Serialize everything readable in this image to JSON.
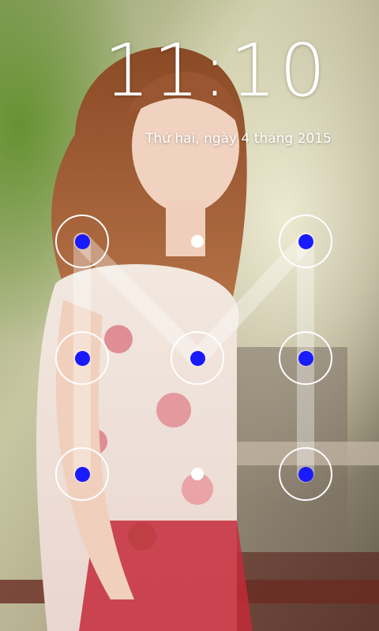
{
  "lockscreen": {
    "time": "11:10",
    "date": "Thứ hai, ngày 4 tháng 2015"
  },
  "pattern_lock": {
    "grid": [
      [
        {
          "id": "r1c1",
          "selected": true
        },
        {
          "id": "r1c2",
          "selected": false
        },
        {
          "id": "r1c3",
          "selected": true
        }
      ],
      [
        {
          "id": "r2c1",
          "selected": true
        },
        {
          "id": "r2c2",
          "selected": true
        },
        {
          "id": "r2c3",
          "selected": true
        }
      ],
      [
        {
          "id": "r3c1",
          "selected": true
        },
        {
          "id": "r3c2",
          "selected": false
        },
        {
          "id": "r3c3",
          "selected": true
        }
      ]
    ],
    "drawn_path": [
      "r3c1",
      "r2c1",
      "r1c1",
      "r2c2",
      "r1c3",
      "r2c3",
      "r3c3"
    ],
    "colors": {
      "ring": "#ffffff",
      "selected_dot": "#1a1aff",
      "idle_dot": "#ffffff",
      "trail": "rgba(255,255,255,0.35)"
    }
  }
}
